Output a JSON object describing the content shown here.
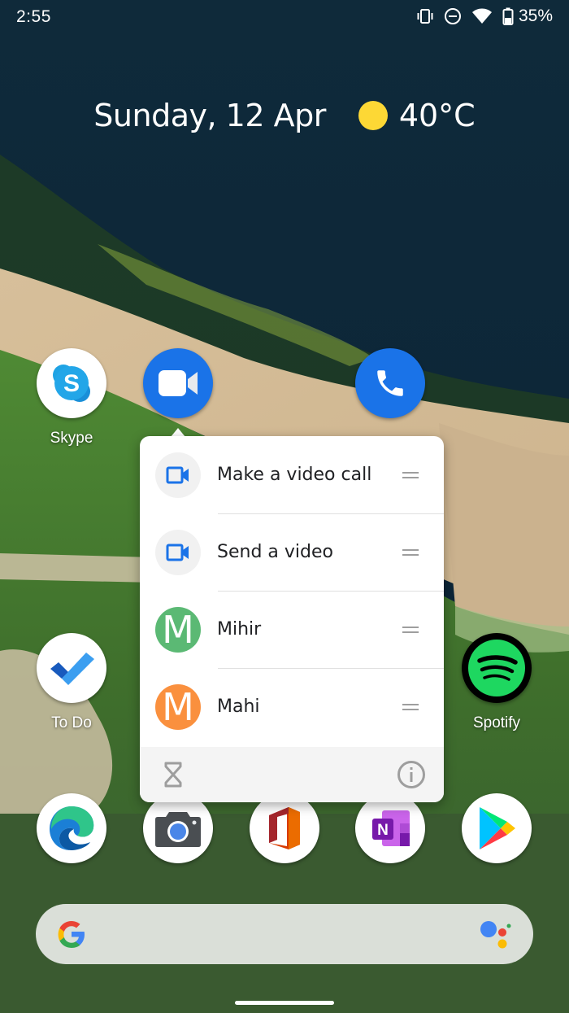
{
  "status_bar": {
    "time": "2:55",
    "icons": [
      "vibrate-icon",
      "do-not-disturb-icon",
      "wifi-icon",
      "battery-icon"
    ],
    "battery_percent": "35%"
  },
  "glance": {
    "date": "Sunday, 12 Apr",
    "weather_icon": "sunny-icon",
    "temperature": "40°C"
  },
  "apps": {
    "skype": {
      "label": "Skype",
      "icon": "skype-icon"
    },
    "duo": {
      "label": "",
      "icon": "duo-video-icon",
      "color": "#1a73e8"
    },
    "phone": {
      "label": "",
      "icon": "phone-icon",
      "color": "#1a73e8"
    },
    "todo": {
      "label": "To Do",
      "icon": "todo-icon"
    },
    "spotify": {
      "label": "Spotify",
      "icon": "spotify-icon",
      "color": "#1ed760"
    }
  },
  "dock": [
    {
      "name": "edge",
      "icon": "edge-icon"
    },
    {
      "name": "camera",
      "icon": "camera-icon"
    },
    {
      "name": "office",
      "icon": "office-icon"
    },
    {
      "name": "onenote",
      "icon": "onenote-icon",
      "letter": "N"
    },
    {
      "name": "play-store",
      "icon": "play-store-icon"
    }
  ],
  "popup": {
    "shortcuts": [
      {
        "label": "Make a video call",
        "icon": "video-call-icon",
        "accent": "#1a73e8"
      },
      {
        "label": "Send a video",
        "icon": "video-call-icon",
        "accent": "#1a73e8"
      },
      {
        "label": "Mihir",
        "avatar_letter": "M",
        "avatar_color": "#5bb974"
      },
      {
        "label": "Mahi",
        "avatar_letter": "M",
        "avatar_color": "#fa903e"
      }
    ],
    "footer": {
      "left_icon": "hourglass-icon",
      "right_icon": "info-icon"
    }
  },
  "search": {
    "left_icon": "google-g-icon",
    "right_icon": "google-assistant-icon"
  }
}
